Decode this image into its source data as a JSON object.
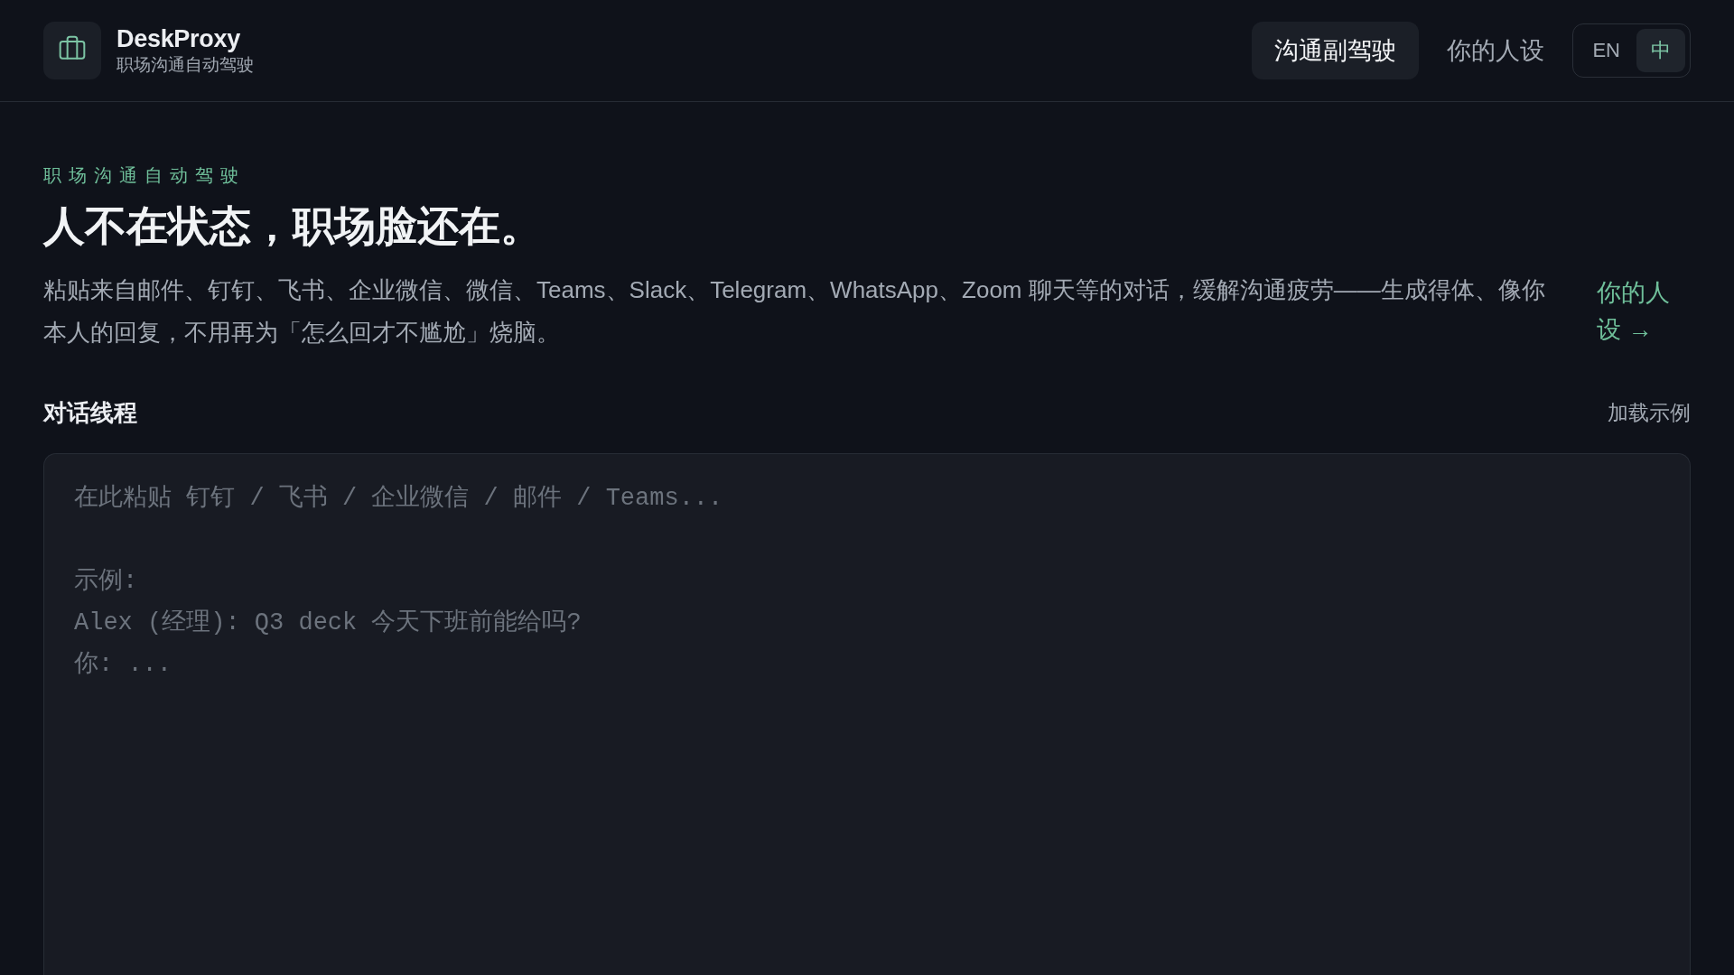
{
  "header": {
    "brand": {
      "name": "DeskProxy",
      "tagline": "职场沟通自动驾驶"
    },
    "nav": [
      {
        "label": "沟通副驾驶",
        "selected": true
      },
      {
        "label": "你的人设",
        "selected": false
      }
    ],
    "language": [
      {
        "label": "EN",
        "selected": false
      },
      {
        "label": "中",
        "selected": true
      }
    ]
  },
  "hero": {
    "kicker": "职场沟通自动驾驶",
    "title": "人不在状态，职场脸还在。",
    "description": "粘贴来自邮件、钉钉、飞书、企业微信、微信、Teams、Slack、Telegram、WhatsApp、Zoom 聊天等的对话，缓解沟通疲劳——生成得体、像你本人的回复，不用再为「怎么回才不尴尬」烧脑。",
    "link": "你的人设 →"
  },
  "thread": {
    "title": "对话线程",
    "action": "加载示例",
    "input": {
      "placeholder": "在此粘贴 钉钉 / 飞书 / 企业微信 / 邮件 / Teams...\n\n示例:\nAlex (经理): Q3 deck 今天下班前能给吗?\n你: ..."
    }
  }
}
